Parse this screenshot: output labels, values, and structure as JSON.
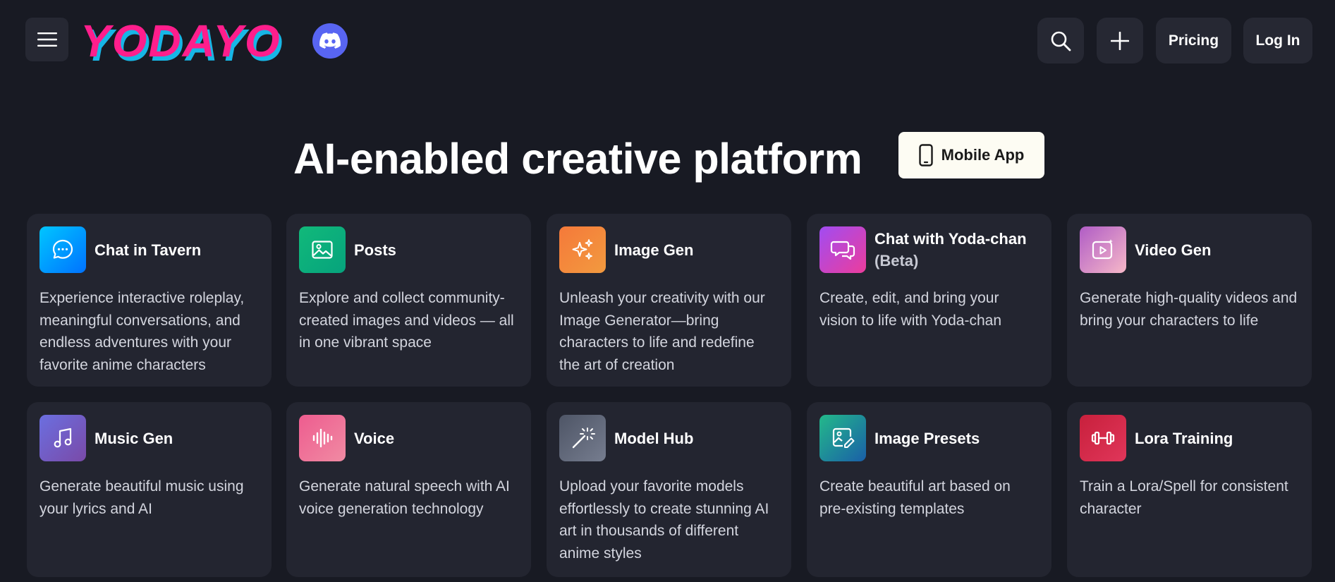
{
  "header": {
    "menu_icon": "hamburger-menu-icon",
    "logo_text": "YODAYO",
    "discord_icon": "discord-icon",
    "search_icon": "search-icon",
    "plus_icon": "plus-icon",
    "pricing_label": "Pricing",
    "login_label": "Log In"
  },
  "hero": {
    "title": "AI-enabled creative platform",
    "mobile_app_label": "Mobile App",
    "mobile_icon": "smartphone-icon"
  },
  "features": [
    {
      "title": "Chat in Tavern",
      "title_extra": "",
      "icon": "chat-bubble-icon",
      "description": "Experience interactive roleplay, meaningful conversations, and endless adventures with your favorite anime characters",
      "gradient": [
        "#00c6ff",
        "#0072ff"
      ]
    },
    {
      "title": "Posts",
      "title_extra": "",
      "icon": "image-icon",
      "description": "Explore and collect community-created images and videos — all in one vibrant space",
      "gradient": [
        "#11b97a",
        "#06a37d"
      ]
    },
    {
      "title": "Image Gen",
      "title_extra": "",
      "icon": "sparkles-icon",
      "description": "Unleash your creativity with our Image Generator—bring characters to life and redefine the art of creation",
      "gradient": [
        "#f5793a",
        "#f29a3f"
      ]
    },
    {
      "title": "Chat with Yoda-chan",
      "title_extra": "(Beta)",
      "icon": "messages-icon",
      "description": "Create, edit, and bring your vision to life with Yoda-chan",
      "gradient": [
        "#a14cf2",
        "#ec3d9c"
      ]
    },
    {
      "title": "Video Gen",
      "title_extra": "",
      "icon": "video-play-icon",
      "description": "Generate high-quality videos and bring your characters to life",
      "gradient": [
        "#b05cc6",
        "#f6b8c8"
      ]
    },
    {
      "title": "Music Gen",
      "title_extra": "",
      "icon": "music-note-icon",
      "description": "Generate beautiful music using your lyrics and AI",
      "gradient": [
        "#6b6fe0",
        "#7a4aa8"
      ]
    },
    {
      "title": "Voice",
      "title_extra": "",
      "icon": "audio-waveform-icon",
      "description": "Generate natural speech with AI voice generation technology",
      "gradient": [
        "#ee5c8f",
        "#f08ba3"
      ]
    },
    {
      "title": "Model Hub",
      "title_extra": "",
      "icon": "magic-wand-icon",
      "description": "Upload your favorite models effortlessly to create stunning AI art in thousands of different anime styles",
      "gradient": [
        "#4e5566",
        "#767d8f"
      ]
    },
    {
      "title": "Image Presets",
      "title_extra": "",
      "icon": "image-edit-icon",
      "description": "Create beautiful art based on pre-existing templates",
      "gradient": [
        "#23b98a",
        "#1a5fa8"
      ]
    },
    {
      "title": "Lora Training",
      "title_extra": "",
      "icon": "dumbbell-icon",
      "description": "Train a Lora/Spell for consistent character",
      "gradient": [
        "#c8203c",
        "#e0365a"
      ]
    }
  ],
  "colors": {
    "background": "#181a23",
    "card": "#232530",
    "button": "#262833",
    "logo_pink": "#ff1e8c",
    "logo_cyan": "#17b6e6",
    "discord": "#5865f2"
  }
}
